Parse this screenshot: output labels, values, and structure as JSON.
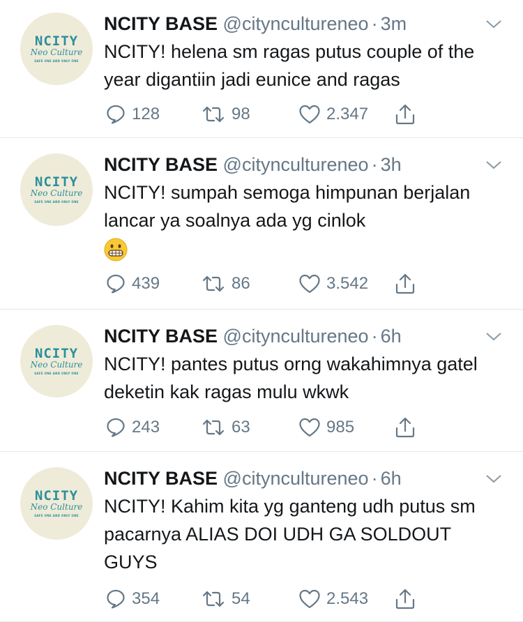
{
  "tweets": [
    {
      "name": "NCITY BASE",
      "handle": "@cityncultureneo",
      "time": "3m",
      "text": "NCITY! helena sm ragas putus couple of the year digantiin jadi eunice and ragas",
      "replies": "128",
      "retweets": "98",
      "likes": "2.347"
    },
    {
      "name": "NCITY BASE",
      "handle": "@cityncultureneo",
      "time": "3h",
      "text": "NCITY! sumpah semoga himpunan berjalan lancar ya soalnya ada yg cinlok",
      "emoji": "grimacing-face",
      "replies": "439",
      "retweets": "86",
      "likes": "3.542"
    },
    {
      "name": "NCITY BASE",
      "handle": "@cityncultureneo",
      "time": "6h",
      "text": "NCITY! pantes putus orng wakahimnya gatel deketin kak ragas mulu wkwk",
      "replies": "243",
      "retweets": "63",
      "likes": "985"
    },
    {
      "name": "NCITY BASE",
      "handle": "@cityncultureneo",
      "time": "6h",
      "text": "NCITY! Kahim kita yg ganteng udh putus sm pacarnya ALIAS DOI UDH GA SOLDOUT GUYS",
      "replies": "354",
      "retweets": "54",
      "likes": "2.543"
    }
  ],
  "avatar": {
    "logo_main": "NCITY",
    "logo_script": "Neo Culture",
    "logo_tag": "SAFE ONE AND ONLY ONE"
  },
  "colors": {
    "text": "#14171a",
    "secondary": "#657786",
    "divider": "#e1e8ed",
    "avatar_bg": "#efebd9",
    "logo": "#2c8f9a"
  },
  "icons": [
    "reply-icon",
    "retweet-icon",
    "like-icon",
    "share-icon",
    "chevron-down-icon"
  ]
}
